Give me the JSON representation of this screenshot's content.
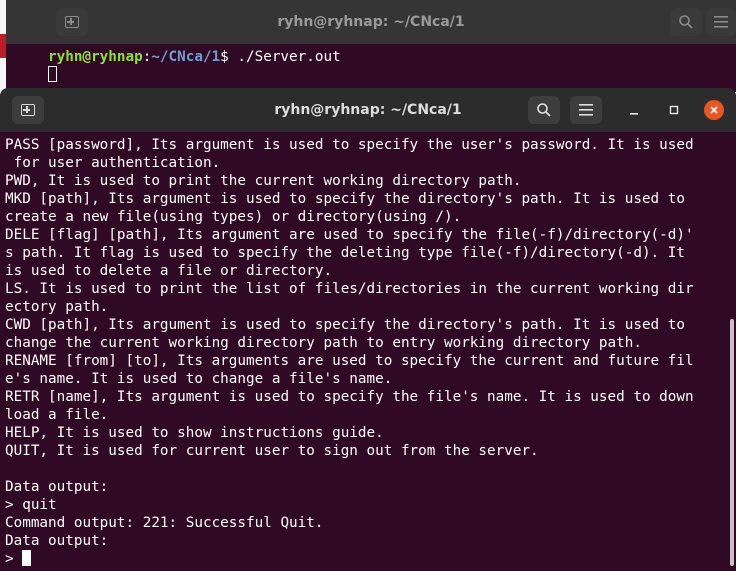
{
  "back_window": {
    "title": "ryhn@ryhnap: ~/CNca/1",
    "prompt_user": "ryhn@ryhnap",
    "prompt_sep": ":",
    "prompt_path": "~/CNca/1",
    "prompt_end": "$ ",
    "command": "./Server.out"
  },
  "front_window": {
    "title": "ryhn@ryhnap: ~/CNca/1",
    "lines": [
      "PASS [password], Its argument is used to specify the user's password. It is used",
      " for user authentication.",
      "PWD, It is used to print the current working directory path.",
      "MKD [path], Its argument is used to specify the directory's path. It is used to",
      "create a new file(using types) or directory(using /).",
      "DELE [flag] [path], Its argument are used to specify the file(-f)/directory(-d)'",
      "s path. It flag is used to specify the deleting type file(-f)/directory(-d). It",
      "is used to delete a file or directory.",
      "LS. It is used to print the list of files/directories in the current working dir",
      "ectory path.",
      "CWD [path], Its argument is used to specify the directory's path. It is used to",
      "change the current working directory path to entry working directory path.",
      "RENAME [from] [to], Its arguments are used to specify the current and future fil",
      "e's name. It is used to change a file's name.",
      "RETR [name], Its argument is used to specify the file's name. It is used to down",
      "load a file.",
      "HELP, It is used to show instructions guide.",
      "QUIT, It is used for current user to sign out from the server.",
      "",
      "Data output:",
      "> quit",
      "Command output: 221: Successful Quit.",
      "Data output:"
    ],
    "last_prompt": "> "
  },
  "icons": {
    "new_tab": "new-tab-icon",
    "search": "search-icon",
    "menu": "hamburger-menu-icon",
    "minimize": "minimize-icon",
    "maximize": "maximize-icon",
    "close": "close-icon"
  },
  "colors": {
    "terminal_bg": "#300a24",
    "prompt_user": "#8ae234",
    "prompt_path": "#729fcf",
    "close_button": "#e95420"
  }
}
